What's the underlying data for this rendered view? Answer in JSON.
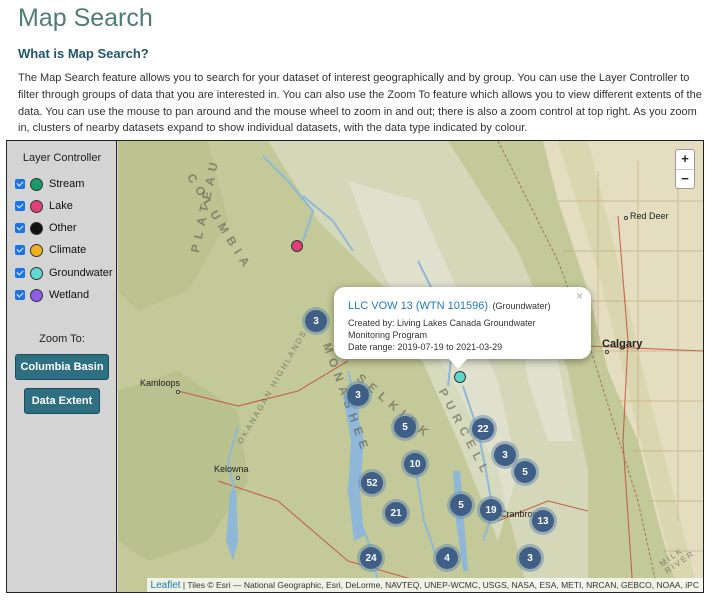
{
  "page": {
    "title": "Map Search",
    "heading": "What is Map Search?",
    "intro": "The Map Search feature allows you to search for your dataset of interest geographically and by group. You can use the Layer Controller to filter through groups of data that you are interested in. You can also use the Zoom To feature which allows you to view different extents of the data. You can use the mouse to pan around and the mouse wheel to zoom in and out; there is also a zoom control at top right. As you zoom in, clusters of nearby datasets expand to show individual datasets, with the data type indicated by colour."
  },
  "layer_controller": {
    "title": "Layer Controller",
    "layers": [
      {
        "label": "Stream",
        "color": "#1a9a6a",
        "checked": true
      },
      {
        "label": "Lake",
        "color": "#e0407a",
        "checked": true
      },
      {
        "label": "Other",
        "color": "#111111",
        "checked": true
      },
      {
        "label": "Climate",
        "color": "#f2b01e",
        "checked": true
      },
      {
        "label": "Groundwater",
        "color": "#5ed8d0",
        "checked": true
      },
      {
        "label": "Wetland",
        "color": "#8e5ee8",
        "checked": true
      }
    ],
    "zoom_title": "Zoom To:",
    "zoom_buttons": [
      "Columbia Basin",
      "Data Extent"
    ]
  },
  "map": {
    "zoom_in": "+",
    "zoom_out": "−",
    "clusters": [
      "3",
      "3",
      "5",
      "22",
      "10",
      "3",
      "5",
      "52",
      "5",
      "19",
      "21",
      "13",
      "24",
      "4",
      "3"
    ],
    "cities": [
      "Red Deer",
      "Calgary",
      "Kamloops",
      "Kelowna",
      "Cranbrook"
    ],
    "regions": [
      "COLUMBIA",
      "PLATEAU",
      "MONASHEE",
      "PURCELL",
      "SELKIRK",
      "OKANAGAN HIGHLANDS",
      "MILK RIVER"
    ],
    "popup": {
      "title": "LLC VOW 13 (WTN 101596)",
      "type": "(Groundwater)",
      "created_by": "Created by: Living Lakes Canada Groundwater",
      "program": "Monitoring Program",
      "date_range": "Date range: 2019-07-19 to 2021-03-29",
      "close": "×"
    },
    "attribution_link": "Leaflet",
    "attribution_text": " | Tiles © Esri — National Geographic, Esri, DeLorme, NAVTEQ, UNEP-WCMC, USGS, NASA, ESA, METI, NRCAN, GEBCO, NOAA, iPC"
  }
}
